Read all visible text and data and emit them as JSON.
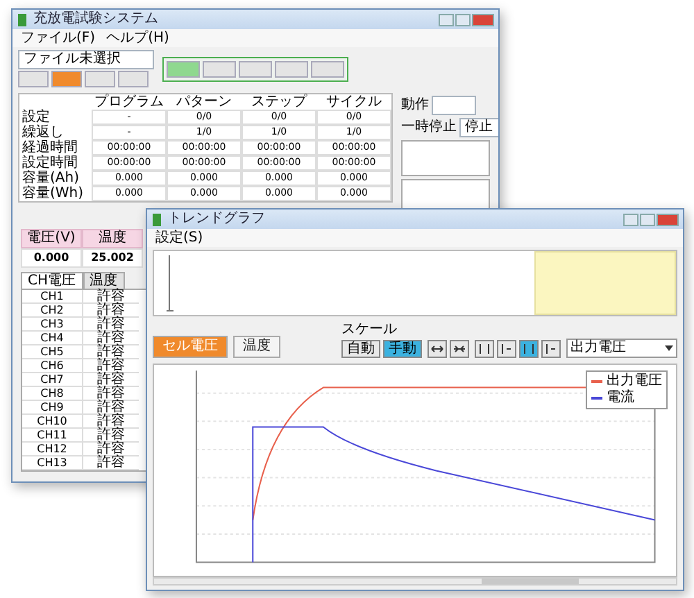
{
  "main_window": {
    "title": "充放電試験システム",
    "menu": [
      "ファイル(F)",
      "ヘルプ(H)"
    ],
    "status_field": {
      "value": "ファイル未選択"
    },
    "mode_buttons": [
      {
        "selected": false
      },
      {
        "selected": true
      },
      {
        "selected": false
      },
      {
        "selected": false
      }
    ],
    "command_buttons": [
      {
        "selected": true
      },
      {
        "selected": false
      },
      {
        "selected": false
      },
      {
        "selected": false
      },
      {
        "selected": false
      }
    ],
    "table": {
      "columns": [
        "プログラム",
        "パターン",
        "ステップ",
        "サイクル"
      ],
      "rows": [
        {
          "label": "設定",
          "cells": [
            "-",
            "0/0",
            "0/0",
            "0/0"
          ]
        },
        {
          "label": "繰返し",
          "cells": [
            "-",
            "1/0",
            "1/0",
            "1/0"
          ]
        },
        {
          "label": "経過時間",
          "cells": [
            "00:00:00",
            "00:00:00",
            "00:00:00",
            "00:00:00"
          ]
        },
        {
          "label": "設定時間",
          "cells": [
            "00:00:00",
            "00:00:00",
            "00:00:00",
            "00:00:00"
          ]
        },
        {
          "label": "容量(Ah)",
          "cells": [
            "0.000",
            "0.000",
            "0.000",
            "0.000"
          ]
        },
        {
          "label": "容量(Wh)",
          "cells": [
            "0.000",
            "0.000",
            "0.000",
            "0.000"
          ]
        }
      ]
    },
    "status": [
      {
        "label": "動作"
      },
      {
        "label": "一時停止",
        "value": "停止"
      }
    ],
    "readouts": [
      {
        "label": "電圧(V)",
        "value": "0.000"
      },
      {
        "label": "温度",
        "value": "25.002"
      }
    ],
    "channel_tabs": [
      {
        "label": "CH電圧",
        "selected": true
      },
      {
        "label": "温度",
        "selected": false
      }
    ],
    "channels": [
      {
        "name": "CH1",
        "status": "許容"
      },
      {
        "name": "CH2",
        "status": "許容"
      },
      {
        "name": "CH3",
        "status": "許容"
      },
      {
        "name": "CH4",
        "status": "許容"
      },
      {
        "name": "CH5",
        "status": "許容"
      },
      {
        "name": "CH6",
        "status": "許容"
      },
      {
        "name": "CH7",
        "status": "許容"
      },
      {
        "name": "CH8",
        "status": "許容"
      },
      {
        "name": "CH9",
        "status": "許容"
      },
      {
        "name": "CH10",
        "status": "許容"
      },
      {
        "name": "CH11",
        "status": "許容"
      },
      {
        "name": "CH12",
        "status": "許容"
      },
      {
        "name": "CH13",
        "status": "許容"
      }
    ]
  },
  "trend_window": {
    "title": "トレンドグラフ",
    "menu": [
      "設定(S)"
    ],
    "series_buttons": [
      {
        "label": "セル電圧",
        "selected": true
      },
      {
        "label": "温度",
        "selected": false
      }
    ],
    "scale": {
      "label": "スケール",
      "options": [
        {
          "label": "自動",
          "selected": false
        },
        {
          "label": "手動",
          "selected": true
        }
      ]
    },
    "display_field": {
      "value": "出力電圧"
    },
    "legend": [
      {
        "name": "出力電圧",
        "color": "#e8604c"
      },
      {
        "name": "電流",
        "color": "#4a48d8"
      }
    ]
  }
}
